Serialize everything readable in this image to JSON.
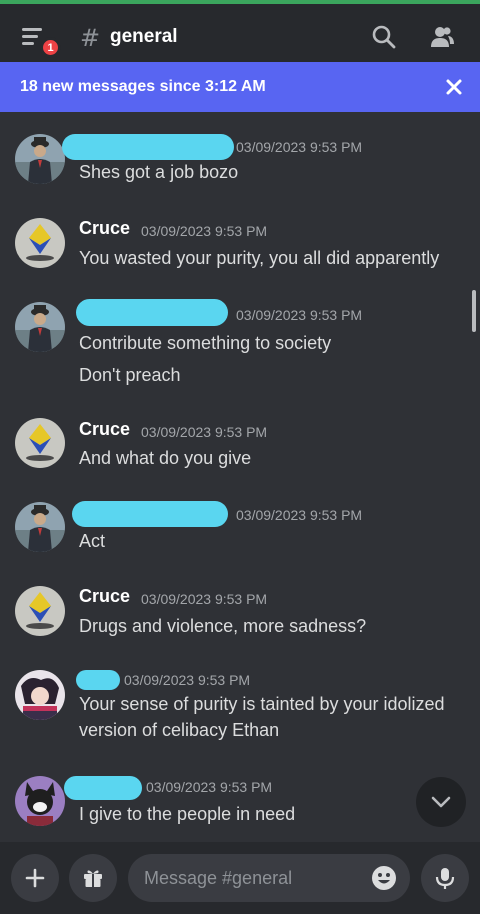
{
  "header": {
    "unread_badge": "1",
    "hash": "#",
    "channel_name": "general"
  },
  "banner": {
    "text": "18 new messages since 3:12 AM"
  },
  "messages": [
    {
      "author": "",
      "avatar": "suit-man",
      "time": "03/09/2023 9:53 PM",
      "lines": [
        "Shes got a job bozo"
      ]
    },
    {
      "author": "Cruce",
      "avatar": "crystal",
      "time": "03/09/2023 9:53 PM",
      "lines": [
        "You wasted your purity, you all did apparently"
      ]
    },
    {
      "author": "",
      "avatar": "suit-man",
      "time": "03/09/2023 9:53 PM",
      "lines": [
        "Contribute something to society",
        "Don't preach"
      ]
    },
    {
      "author": "Cruce",
      "avatar": "crystal",
      "time": "03/09/2023 9:53 PM",
      "lines": [
        "And what do you give"
      ]
    },
    {
      "author": "",
      "avatar": "suit-man",
      "time": "03/09/2023 9:53 PM",
      "lines": [
        "Act"
      ]
    },
    {
      "author": "Cruce",
      "avatar": "crystal",
      "time": "03/09/2023 9:53 PM",
      "lines": [
        "Drugs and violence, more sadness?"
      ]
    },
    {
      "author": "",
      "avatar": "anime",
      "time": "03/09/2023 9:53 PM",
      "lines": [
        "Your sense of purity is tainted by your idolized version of celibacy Ethan"
      ]
    },
    {
      "author": "",
      "avatar": "furry",
      "time": "03/09/2023 9:53 PM",
      "lines": [
        "I give to the people in need"
      ]
    }
  ],
  "composer": {
    "placeholder": "Message #general"
  },
  "icons": {
    "menu": "menu-icon",
    "search": "search-icon",
    "members": "members-icon",
    "close": "close-icon",
    "jump": "chevron-down-icon",
    "add": "plus-icon",
    "gift": "gift-icon",
    "emoji": "emoji-icon",
    "mic": "microphone-icon"
  },
  "colors": {
    "background": "#2f3136",
    "banner": "#5865f2",
    "badge": "#ed4245",
    "online_bar": "#3ba55d",
    "redaction": "#5ad6f0"
  }
}
